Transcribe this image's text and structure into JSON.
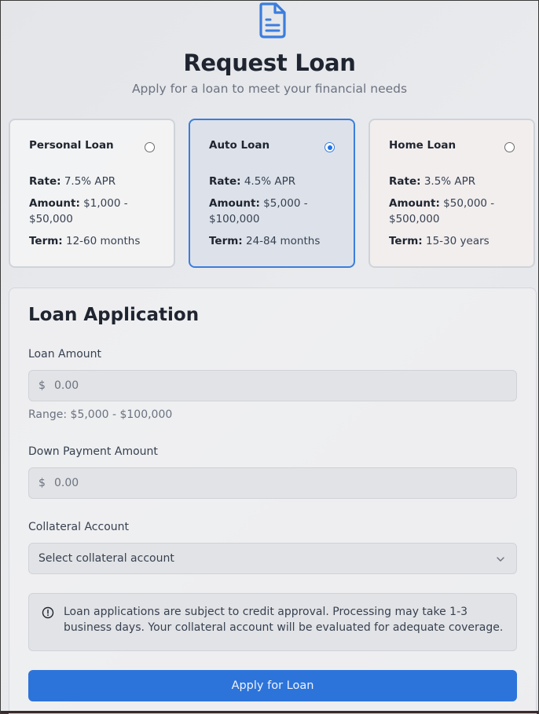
{
  "header": {
    "title": "Request Loan",
    "subtitle": "Apply for a loan to meet your financial needs",
    "icon": "document-icon"
  },
  "loan_types": [
    {
      "name": "Personal Loan",
      "selected": false,
      "rate_label": "Rate:",
      "rate": "7.5% APR",
      "amount_label": "Amount:",
      "amount": "$1,000 - $50,000",
      "term_label": "Term:",
      "term": "12-60 months"
    },
    {
      "name": "Auto Loan",
      "selected": true,
      "rate_label": "Rate:",
      "rate": "4.5% APR",
      "amount_label": "Amount:",
      "amount": "$5,000 - $100,000",
      "term_label": "Term:",
      "term": "24-84 months"
    },
    {
      "name": "Home Loan",
      "selected": false,
      "rate_label": "Rate:",
      "rate": "3.5% APR",
      "amount_label": "Amount:",
      "amount": "$50,000 - $500,000",
      "term_label": "Term:",
      "term": "15-30 years"
    }
  ],
  "form": {
    "title": "Loan Application",
    "loan_amount": {
      "label": "Loan Amount",
      "currency": "$",
      "placeholder": "0.00",
      "hint": "Range: $5,000 - $100,000"
    },
    "down_payment": {
      "label": "Down Payment Amount",
      "currency": "$",
      "placeholder": "0.00"
    },
    "collateral": {
      "label": "Collateral Account",
      "selected": "Select collateral account"
    },
    "notice": "Loan applications are subject to credit approval. Processing may take 1-3 business days. Your collateral account will be evaluated for adequate coverage.",
    "submit_label": "Apply for Loan"
  },
  "colors": {
    "accent": "#2d74da",
    "selected_border": "#3b7ddd"
  }
}
